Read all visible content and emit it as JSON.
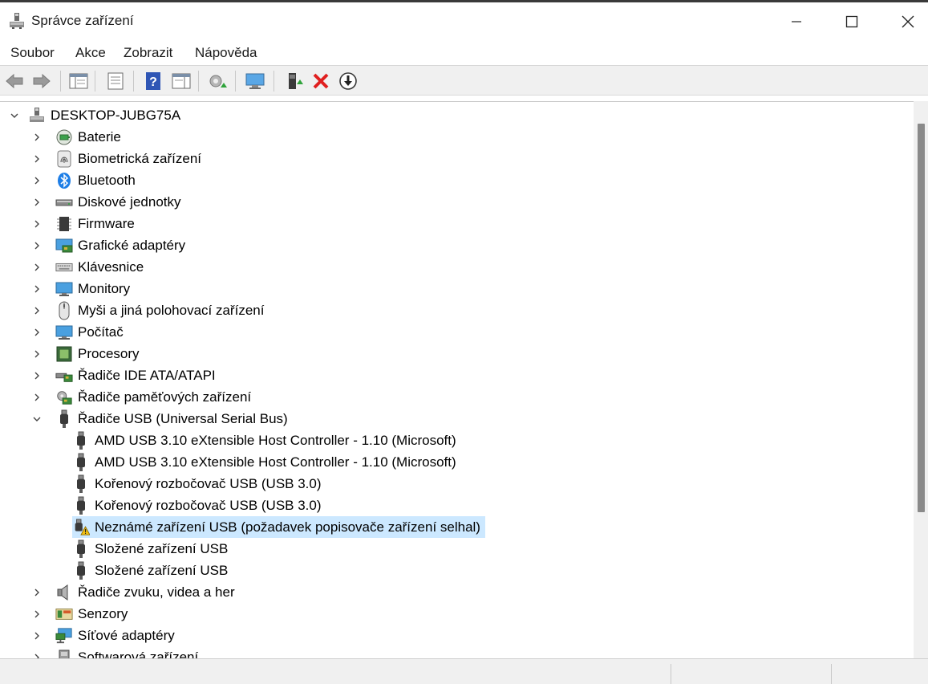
{
  "window": {
    "title": "Správce zařízení",
    "buttons": [
      "minimize",
      "maximize",
      "close"
    ]
  },
  "menu": [
    "Soubor",
    "Akce",
    "Zobrazit",
    "Nápověda"
  ],
  "toolbar": {
    "buttons": [
      "back-icon",
      "forward-icon",
      "show-hide-console-tree-icon",
      "properties-icon",
      "help-icon",
      "action-pane-icon",
      "update-driver-icon",
      "scan-hardware-icon",
      "enable-device-icon",
      "uninstall-device-icon",
      "disable-device-icon"
    ]
  },
  "tree": {
    "root": "DESKTOP-JUBG75A",
    "categories": [
      {
        "label": "Baterie",
        "icon": "battery-icon"
      },
      {
        "label": "Biometrická zařízení",
        "icon": "fingerprint-icon"
      },
      {
        "label": "Bluetooth",
        "icon": "bluetooth-icon"
      },
      {
        "label": "Diskové jednotky",
        "icon": "disk-drive-icon"
      },
      {
        "label": "Firmware",
        "icon": "firmware-chip-icon"
      },
      {
        "label": "Grafické adaptéry",
        "icon": "display-adapter-icon"
      },
      {
        "label": "Klávesnice",
        "icon": "keyboard-icon"
      },
      {
        "label": "Monitory",
        "icon": "monitor-icon"
      },
      {
        "label": "Myši a jiná polohovací zařízení",
        "icon": "mouse-icon"
      },
      {
        "label": "Počítač",
        "icon": "computer-icon"
      },
      {
        "label": "Procesory",
        "icon": "processor-icon"
      },
      {
        "label": "Řadiče IDE ATA/ATAPI",
        "icon": "ide-controller-icon"
      },
      {
        "label": "Řadiče paměťových zařízení",
        "icon": "storage-controller-icon"
      },
      {
        "label": "Řadiče USB (Universal Serial Bus)",
        "icon": "usb-connector-icon",
        "expanded": true
      },
      {
        "label": "Řadiče zvuku, videa a her",
        "icon": "speaker-icon"
      },
      {
        "label": "Senzory",
        "icon": "sensor-icon"
      },
      {
        "label": "Síťové adaptéry",
        "icon": "network-adapter-icon"
      },
      {
        "label": "Softwarová zařízení",
        "icon": "software-device-icon"
      }
    ],
    "usb_children": [
      {
        "label": "AMD USB 3.10 eXtensible Host Controller - 1.10 (Microsoft)",
        "icon": "usb-connector-icon"
      },
      {
        "label": "AMD USB 3.10 eXtensible Host Controller - 1.10 (Microsoft)",
        "icon": "usb-connector-icon"
      },
      {
        "label": "Kořenový rozbočovač USB (USB 3.0)",
        "icon": "usb-connector-icon"
      },
      {
        "label": "Kořenový rozbočovač USB (USB 3.0)",
        "icon": "usb-connector-icon"
      },
      {
        "label": "Neznámé zařízení USB (požadavek popisovače zařízení selhal)",
        "icon": "usb-warning-icon",
        "selected": true
      },
      {
        "label": "Složené zařízení USB",
        "icon": "usb-connector-icon"
      },
      {
        "label": "Složené zařízení USB",
        "icon": "usb-connector-icon"
      }
    ]
  }
}
